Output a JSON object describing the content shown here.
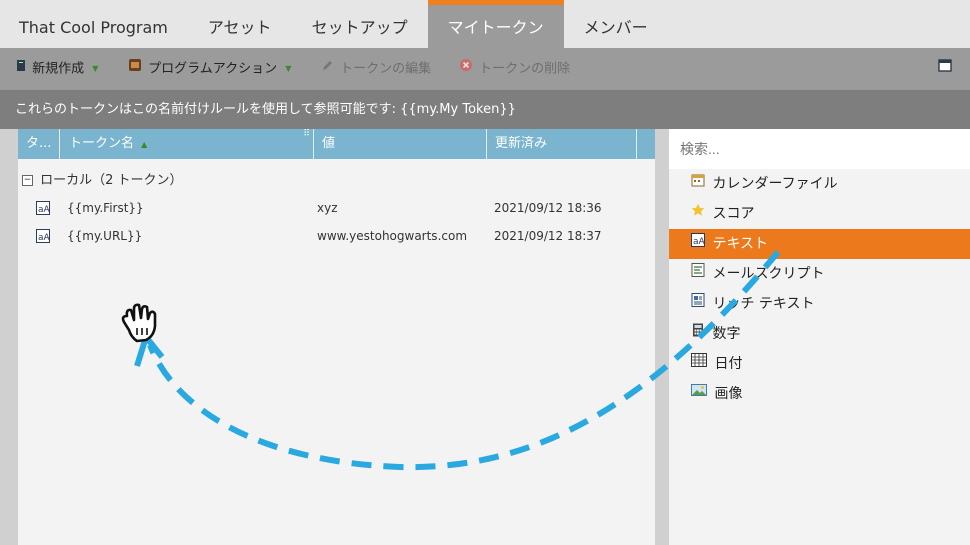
{
  "tabs": [
    {
      "label": "That Cool Program",
      "active": false
    },
    {
      "label": "アセット",
      "active": false
    },
    {
      "label": "セットアップ",
      "active": false
    },
    {
      "label": "マイトークン",
      "active": true
    },
    {
      "label": "メンバー",
      "active": false
    }
  ],
  "toolbar": {
    "new_label": "新規作成",
    "program_action_label": "プログラムアクション",
    "edit_label": "トークンの編集",
    "delete_label": "トークンの削除"
  },
  "notice": "これらのトークンはこの名前付けルールを使用して参照可能です: {{my.My Token}}",
  "table": {
    "columns": [
      "タ...",
      "トークン名",
      "値",
      "更新済み"
    ],
    "group_label": "ローカル（2 トークン）",
    "rows": [
      {
        "name": "{{my.First}}",
        "value": "xyz",
        "updated": "2021/09/12 18:36"
      },
      {
        "name": "{{my.URL}}",
        "value": "www.yestohogwarts.com",
        "updated": "2021/09/12 18:37"
      }
    ]
  },
  "palette": {
    "search_placeholder": "検索...",
    "items": [
      {
        "label": "カレンダーファイル",
        "icon": "calendar-icon",
        "selected": false
      },
      {
        "label": "スコア",
        "icon": "star-icon",
        "selected": false
      },
      {
        "label": "テキスト",
        "icon": "text-token-icon",
        "selected": true
      },
      {
        "label": "メールスクリプト",
        "icon": "script-icon",
        "selected": false
      },
      {
        "label": "リッチ テキスト",
        "icon": "rich-text-icon",
        "selected": false
      },
      {
        "label": "数字",
        "icon": "calculator-icon",
        "selected": false
      },
      {
        "label": "日付",
        "icon": "date-grid-icon",
        "selected": false
      },
      {
        "label": "画像",
        "icon": "image-icon",
        "selected": false
      }
    ]
  },
  "colors": {
    "accent": "#ec7a1c",
    "header_blue": "#7ab4cf",
    "arrow": "#29a9df"
  }
}
